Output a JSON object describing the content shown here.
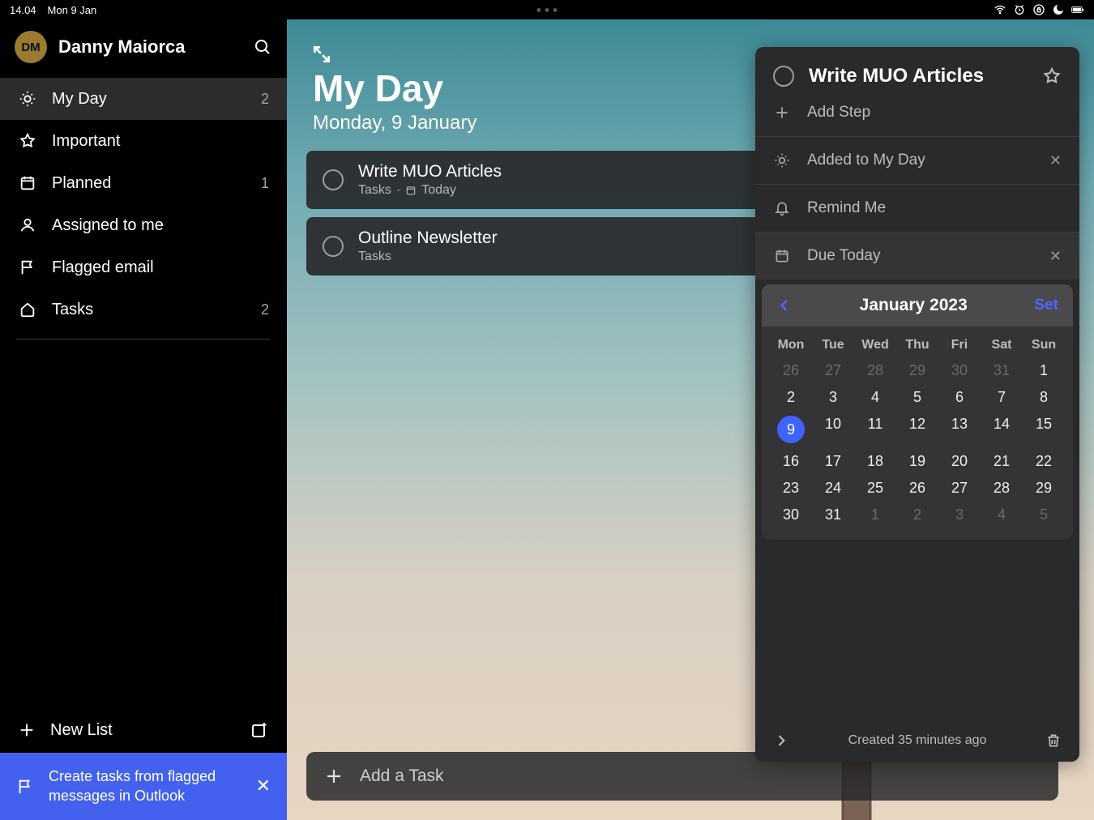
{
  "status": {
    "time": "14.04",
    "date": "Mon 9 Jan"
  },
  "user": {
    "initials": "DM",
    "name": "Danny Maiorca"
  },
  "nav": {
    "myDay": {
      "label": "My Day",
      "count": "2"
    },
    "important": {
      "label": "Important",
      "count": ""
    },
    "planned": {
      "label": "Planned",
      "count": "1"
    },
    "assigned": {
      "label": "Assigned to me",
      "count": ""
    },
    "flagged": {
      "label": "Flagged email",
      "count": ""
    },
    "tasks": {
      "label": "Tasks",
      "count": "2"
    }
  },
  "newList": "New List",
  "banner": {
    "text": "Create tasks from flagged messages in Outlook"
  },
  "main": {
    "title": "My Day",
    "subtitle": "Monday, 9 January",
    "tasks": [
      {
        "title": "Write MUO Articles",
        "sub1": "Tasks",
        "sub2": "Today"
      },
      {
        "title": "Outline Newsletter",
        "sub1": "Tasks",
        "sub2": ""
      }
    ],
    "addTask": "Add a Task"
  },
  "detail": {
    "title": "Write MUO Articles",
    "addStep": "Add Step",
    "addedMyDay": "Added to My Day",
    "remindMe": "Remind Me",
    "dueToday": "Due Today",
    "calendar": {
      "monthLabel": "January 2023",
      "setLabel": "Set",
      "dow": [
        "Mon",
        "Tue",
        "Wed",
        "Thu",
        "Fri",
        "Sat",
        "Sun"
      ],
      "rows": [
        [
          "26",
          "27",
          "28",
          "29",
          "30",
          "31",
          "1"
        ],
        [
          "2",
          "3",
          "4",
          "5",
          "6",
          "7",
          "8"
        ],
        [
          "9",
          "10",
          "11",
          "12",
          "13",
          "14",
          "15"
        ],
        [
          "16",
          "17",
          "18",
          "19",
          "20",
          "21",
          "22"
        ],
        [
          "23",
          "24",
          "25",
          "26",
          "27",
          "28",
          "29"
        ],
        [
          "30",
          "31",
          "1",
          "2",
          "3",
          "4",
          "5"
        ]
      ],
      "dimRows": {
        "0": [
          0,
          1,
          2,
          3,
          4,
          5
        ],
        "5": [
          2,
          3,
          4,
          5,
          6
        ]
      },
      "today": {
        "row": 2,
        "col": 0
      }
    },
    "footer": "Created 35 minutes ago"
  }
}
